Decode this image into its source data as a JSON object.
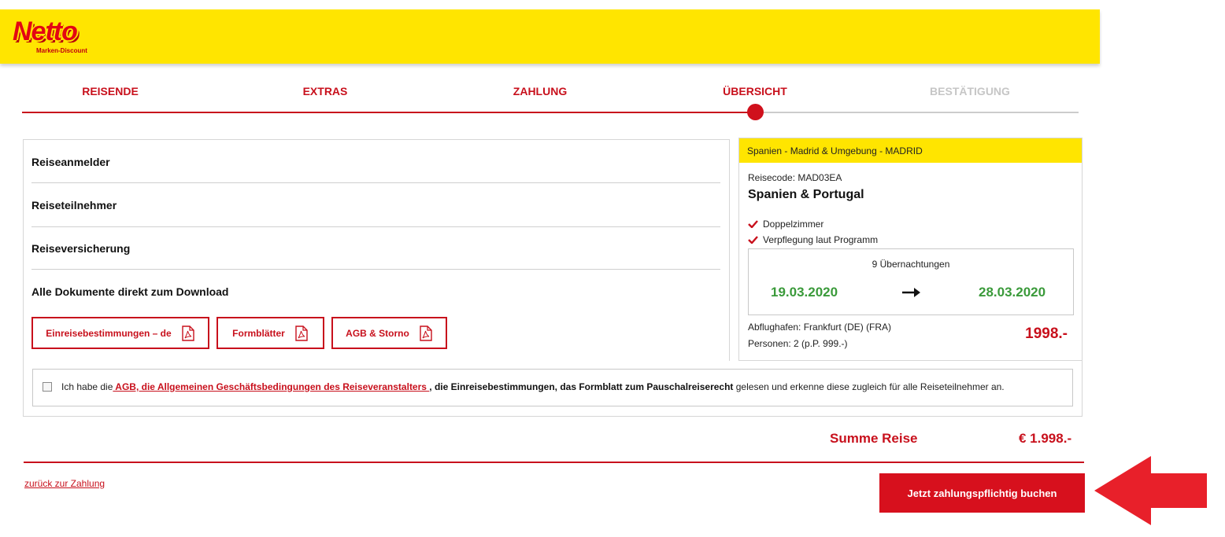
{
  "header": {
    "logo_text": "Netto",
    "logo_sub": "Marken-Discount",
    "brand_color": "#ffe500"
  },
  "steps": [
    {
      "label": "REISENDE",
      "state": "done"
    },
    {
      "label": "EXTRAS",
      "state": "done"
    },
    {
      "label": "ZAHLUNG",
      "state": "done"
    },
    {
      "label": "ÜBERSICHT",
      "state": "active"
    },
    {
      "label": "BESTÄTIGUNG",
      "state": "inactive"
    }
  ],
  "sections": {
    "reiseanmelder": "Reiseanmelder",
    "reiseteilnehmer": "Reiseteilnehmer",
    "reiseversicherung": "Reiseversicherung",
    "dokumente": "Alle Dokumente direkt zum Download"
  },
  "documents": [
    {
      "label": "Einreisebestimmungen – de",
      "icon": "pdf-icon"
    },
    {
      "label": "Formblätter",
      "icon": "pdf-icon"
    },
    {
      "label": "AGB & Storno",
      "icon": "pdf-icon"
    }
  ],
  "trip": {
    "destination": "Spanien - Madrid & Umgebung - MADRID",
    "code": "Reisecode: MAD03EA",
    "title": "Spanien & Portugal",
    "features": [
      "Doppelzimmer",
      "Verpflegung laut Programm"
    ],
    "nights": "9 Übernachtungen",
    "date_from": "19.03.2020",
    "date_to": "28.03.2020",
    "airport": "Abflughafen: Frankfurt (DE) (FRA)",
    "persons": "Personen: 2 (p.P. 999.-)",
    "price": "1998.-"
  },
  "agb": {
    "text_prefix": "Ich habe die",
    "link": " AGB, die Allgemeinen Geschäftsbedingungen des Reiseveranstalters ",
    "bold_part": ", die Einreisebestimmungen, das Formblatt zum Pauschalreiserecht",
    "text_suffix": " gelesen und erkenne diese zugleich für alle Reiseteilnehmer an.",
    "checked": false
  },
  "summary": {
    "label": "Summe Reise",
    "value": "€ 1.998.-"
  },
  "footer": {
    "back_link": "zurück zur Zahlung",
    "book_button": "Jetzt zahlungspflichtig buchen"
  },
  "colors": {
    "accent_red": "#c8101c",
    "date_green": "#3a9a3a",
    "arrow_red": "#e8202a"
  }
}
